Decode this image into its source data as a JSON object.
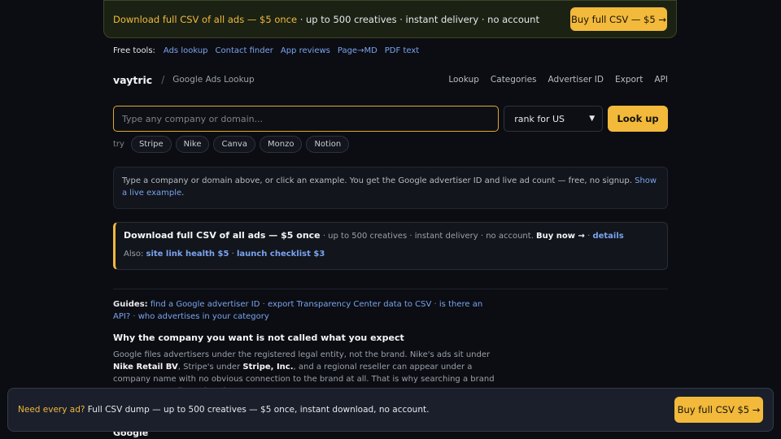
{
  "top_promo": {
    "highlight": "Download full CSV of all ads — $5 once",
    "rest": " · up to 500 creatives · instant delivery · no account",
    "button": "Buy full CSV — $5 →"
  },
  "free_tools": {
    "label": "Free tools:",
    "links": [
      "Ads lookup",
      "Contact finder",
      "App reviews",
      "Page→MD",
      "PDF text"
    ]
  },
  "nav": {
    "brand": "vaytric",
    "separator": "/",
    "subtitle": "Google Ads Lookup",
    "links": [
      "Lookup",
      "Categories",
      "Advertiser ID",
      "Export",
      "API"
    ]
  },
  "search": {
    "placeholder": "Type any company or domain...",
    "value": "",
    "select_value": "rank for US",
    "button": "Look up"
  },
  "try": {
    "label": "try",
    "chips": [
      "Stripe",
      "Nike",
      "Canva",
      "Monzo",
      "Notion"
    ]
  },
  "info": {
    "text": "Type a company or domain above, or click an example. You get the Google advertiser ID and live ad count — free, no signup. ",
    "link": "Show a live example",
    "end": "."
  },
  "download_box": {
    "title": "Download full CSV of all ads — $5 once",
    "meta": " · up to 500 creatives · instant delivery · no account. ",
    "buy": "Buy now →",
    "sep": " · ",
    "details": "details",
    "also_label": "Also: ",
    "also_link1": "site link health $5",
    "also_sep": " · ",
    "also_link2": "launch checklist $3"
  },
  "guides": {
    "label": "Guides:",
    "links": [
      "find a Google advertiser ID",
      "export Transparency Center data to CSV",
      "is there an API?",
      "who advertises in your category"
    ]
  },
  "section": {
    "heading": "Why the company you want is not called what you expect",
    "p1": "Google files advertisers under the registered legal entity, not the brand. Nike's ads sit under ",
    "b1": "Nike Retail BV",
    "p2": ", Stripe's under ",
    "b2": "Stripe, Inc.",
    "p3": ", and a regional reseller can appear under a company name with no obvious connection to the brand at all. That is why searching a brand name returns a list rather than one answer.",
    "next_heading_peek": "Google"
  },
  "sticky": {
    "highlight": "Need every ad?",
    "rest": " Full CSV dump — up to 500 creatives — $5 once, instant download, no account.",
    "button": "Buy full CSV $5 →"
  },
  "colors": {
    "accent": "#f2b93b",
    "link": "#7aa3f0",
    "background": "#0b0d12"
  }
}
